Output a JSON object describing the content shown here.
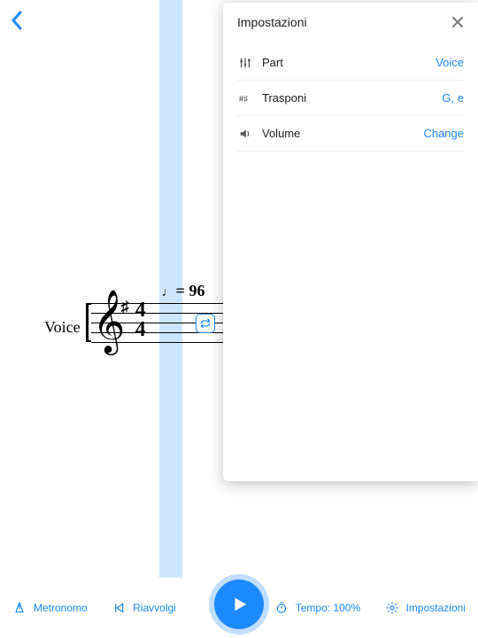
{
  "header": {
    "back": "Back"
  },
  "score": {
    "voice_label": "Voice",
    "tempo_prefix": "= ",
    "tempo_bpm": "96",
    "timesig_top": "4",
    "timesig_bottom": "4"
  },
  "panel": {
    "title": "Impostazioni",
    "rows": {
      "part": {
        "label": "Part",
        "value": "Voice"
      },
      "transp": {
        "label": "Trasponi",
        "value": "G, e"
      },
      "volume": {
        "label": "Volume",
        "value": "Change"
      }
    }
  },
  "toolbar": {
    "metronome": "Metronomo",
    "rewind": "Riavvolgi",
    "tempo": "Tempo: 100%",
    "settings": "Impostazioni"
  }
}
